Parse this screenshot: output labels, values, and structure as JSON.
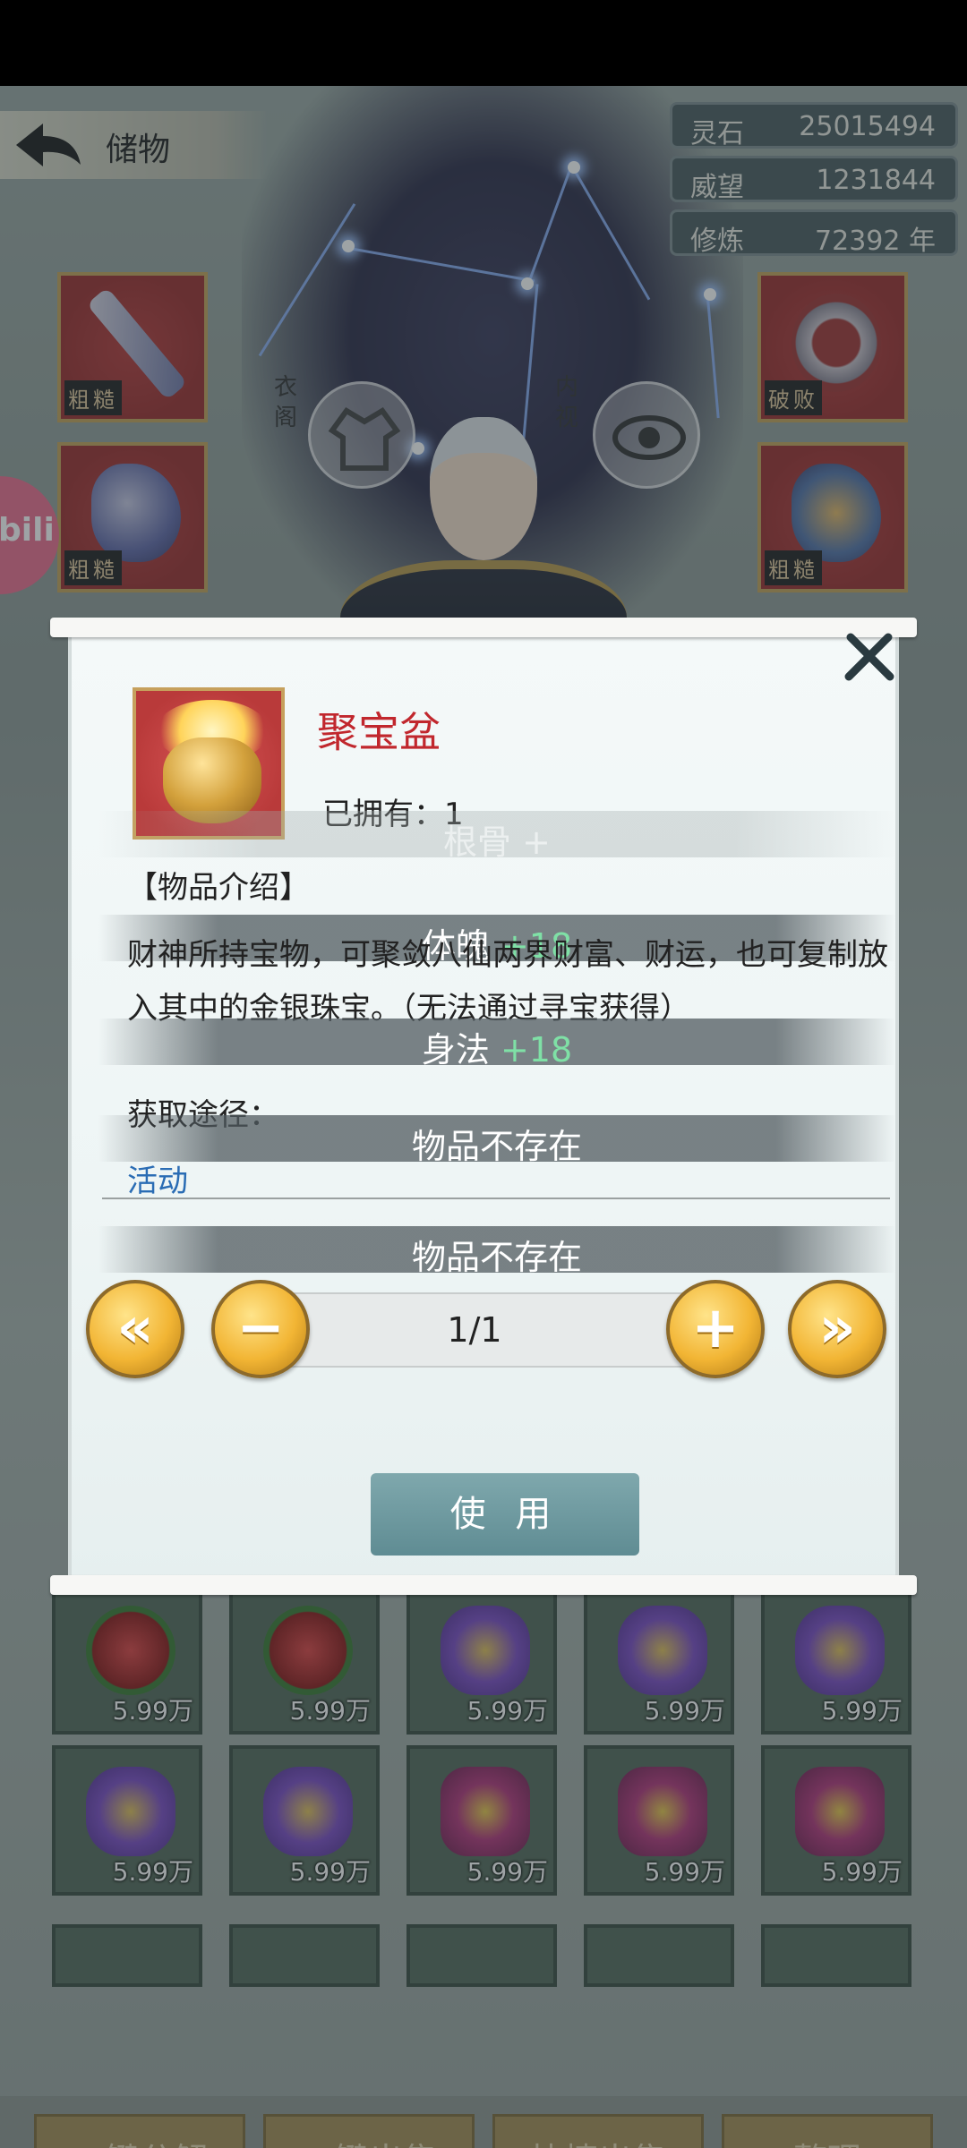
{
  "header": {
    "back_title": "储物"
  },
  "stats": [
    {
      "label": "灵石",
      "value": "25015494"
    },
    {
      "label": "威望",
      "value": "1231844"
    },
    {
      "label": "修炼",
      "value": "72392 年"
    }
  ],
  "character": {
    "left_btn_label": "衣阁",
    "right_btn_label": "内视"
  },
  "equip_tag": "粗糙",
  "equip_tag_ring": "破败",
  "bili_label": "bili",
  "dialog": {
    "item_name": "聚宝盆",
    "owned": "已拥有：1",
    "intro_title": "【物品介绍】",
    "description": "财神所持宝物，可聚敛八仙两界财富、财运，也可复制放入其中的金银珠宝。（无法通过寻宝获得）",
    "source_title": "获取途径：",
    "source_value": "活动",
    "page": "1/1",
    "use_label": "使 用"
  },
  "overlay_bands": {
    "gengu": "根骨  +",
    "tipo": "体魄",
    "tipo_val": "+18",
    "shenfa": "身法",
    "shenfa_val": "+18",
    "missing1": "物品不存在",
    "missing2": "物品不存在"
  },
  "inventory": {
    "price": "5.99万"
  },
  "bottom_buttons": [
    "一键分解",
    "一键出售",
    "快捷出售",
    "整理"
  ],
  "colors": {
    "item_name": "#c1272d",
    "source_link": "#2a6cb4",
    "stat_green": "#7fe0a6",
    "gold_button": "#f2b534"
  }
}
